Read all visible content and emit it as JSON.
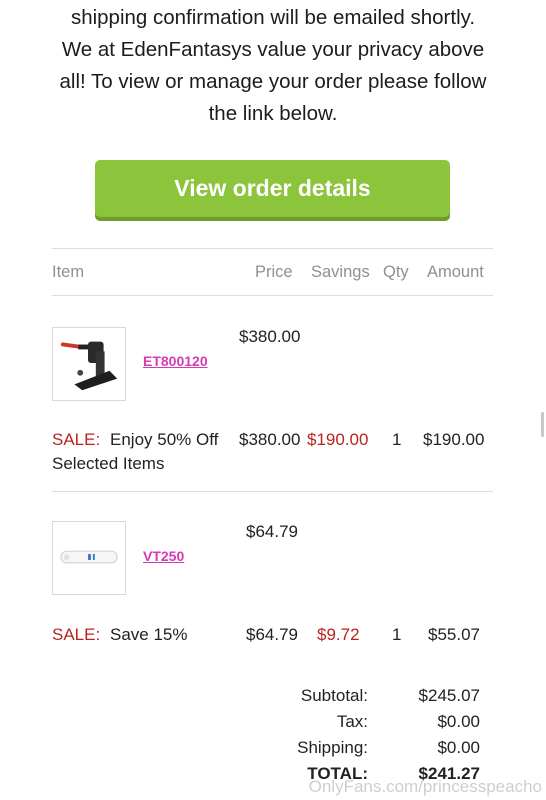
{
  "intro": {
    "lines": [
      "shipping confirmation will be emailed shortly.",
      "We at EdenFantasys value your privacy above",
      "all! To view or manage your order please follow",
      "the link below."
    ]
  },
  "button": {
    "label": "View order details"
  },
  "table": {
    "headers": {
      "item": "Item",
      "price": "Price",
      "savings": "Savings",
      "qty": "Qty",
      "amount": "Amount"
    },
    "rows": [
      {
        "sku": "ET800120",
        "list_price": "$380.00",
        "sale_label": "SALE:",
        "sale_text": "Enjoy 50% Off",
        "sale_text_2": "Selected Items",
        "price": "$380.00",
        "savings": "$190.00",
        "qty": "1",
        "amount": "$190.00"
      },
      {
        "sku": "VT250",
        "list_price": "$64.79",
        "sale_label": "SALE:",
        "sale_text": "Save 15%",
        "price": "$64.79",
        "savings": "$9.72",
        "qty": "1",
        "amount": "$55.07"
      }
    ]
  },
  "totals": {
    "subtotal_label": "Subtotal:",
    "subtotal": "$245.07",
    "tax_label": "Tax:",
    "tax": "$0.00",
    "shipping_label": "Shipping:",
    "shipping": "$0.00",
    "total_label": "TOTAL:",
    "total": "$241.27"
  },
  "watermark": "OnlyFans.com/princesspeacho",
  "colors": {
    "button": "#8cc43c",
    "sale": "#b8241e",
    "sku_link": "#d43bb5"
  }
}
